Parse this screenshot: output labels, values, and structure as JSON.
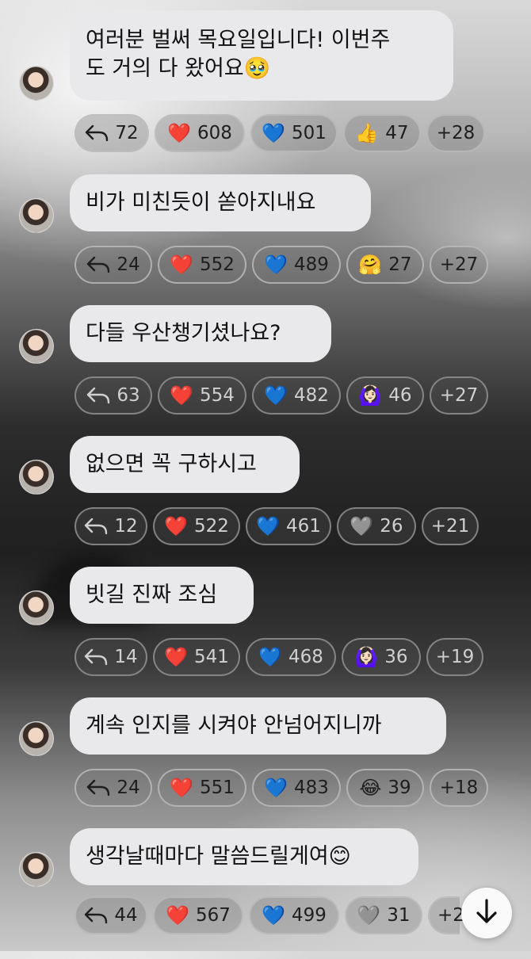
{
  "messages": [
    {
      "text_lines": [
        "여러분 벌써 목요일입니다! 이번주",
        "도 거의 다 왔어요🥹"
      ],
      "reactions": {
        "replies": "72",
        "red_heart": "608",
        "blue_heart": "501",
        "emoji3": "👍",
        "emoji3_count": "47",
        "more": "+28"
      }
    },
    {
      "text_lines": [
        "비가 미친듯이 쏟아지내요"
      ],
      "reactions": {
        "replies": "24",
        "red_heart": "552",
        "blue_heart": "489",
        "emoji3": "🤗",
        "emoji3_count": "27",
        "more": "+27"
      }
    },
    {
      "text_lines": [
        "다들 우산챙기셨나요?"
      ],
      "reactions": {
        "replies": "63",
        "red_heart": "554",
        "blue_heart": "482",
        "emoji3": "🙆🏻‍♀️",
        "emoji3_count": "46",
        "more": "+27"
      }
    },
    {
      "text_lines": [
        "없으면 꼭 구하시고"
      ],
      "reactions": {
        "replies": "12",
        "red_heart": "522",
        "blue_heart": "461",
        "emoji3": "🩶",
        "emoji3_count": "26",
        "more": "+21"
      }
    },
    {
      "text_lines": [
        "빗길 진짜 조심"
      ],
      "reactions": {
        "replies": "14",
        "red_heart": "541",
        "blue_heart": "468",
        "emoji3": "🙆🏻‍♀️",
        "emoji3_count": "36",
        "more": "+19"
      }
    },
    {
      "text_lines": [
        "계속 인지를 시켜야 안넘어지니까"
      ],
      "reactions": {
        "replies": "24",
        "red_heart": "551",
        "blue_heart": "483",
        "emoji3": "😂",
        "emoji3_count": "39",
        "more": "+18"
      }
    },
    {
      "text_lines": [
        "생각날때마다 말씀드릴게여😊"
      ],
      "reactions": {
        "replies": "44",
        "red_heart": "567",
        "blue_heart": "499",
        "emoji3": "🩶",
        "emoji3_count": "31",
        "more": "+2"
      }
    }
  ],
  "icons": {
    "red_heart": "❤️",
    "blue_heart": "💙",
    "reply": "reply-arrow-icon",
    "scroll_down": "arrow-down-icon"
  }
}
